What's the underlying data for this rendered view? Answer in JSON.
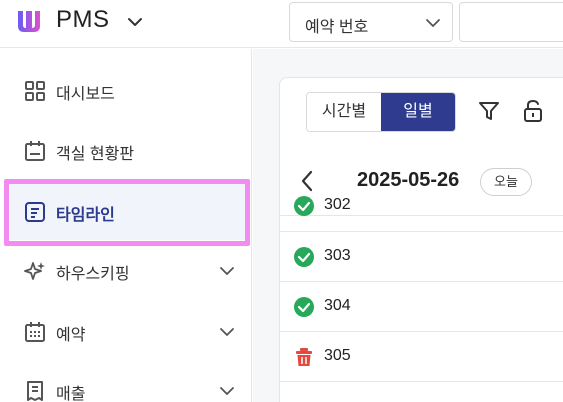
{
  "header": {
    "app_name": "PMS",
    "search_select_value": "예약 번호",
    "search_input_placeholder": ""
  },
  "sidebar": {
    "items": [
      {
        "label": "대시보드",
        "icon": "dashboard-grid-icon",
        "expandable": false,
        "active": false
      },
      {
        "label": "객실 현황판",
        "icon": "calendar-board-icon",
        "expandable": false,
        "active": false
      },
      {
        "label": "타임라인",
        "icon": "timeline-doc-icon",
        "expandable": false,
        "active": true
      },
      {
        "label": "하우스키핑",
        "icon": "sparkle-icon",
        "expandable": true,
        "active": false
      },
      {
        "label": "예약",
        "icon": "calendar-grid-icon",
        "expandable": true,
        "active": false
      },
      {
        "label": "매출",
        "icon": "receipt-icon",
        "expandable": true,
        "active": false
      }
    ]
  },
  "main": {
    "view_toggle": {
      "options": [
        "시간별",
        "일별"
      ],
      "selected": "일별"
    },
    "date": "2025-05-26",
    "today_label": "오늘",
    "rooms": [
      {
        "number": "302",
        "status": "check-circle-icon"
      },
      {
        "number": "303",
        "status": "check-circle-icon"
      },
      {
        "number": "304",
        "status": "check-circle-icon"
      },
      {
        "number": "305",
        "status": "trash-icon"
      }
    ]
  },
  "colors": {
    "accent": "#2e3b8f",
    "active_bg": "#f1f5fb",
    "highlight": "#f28cf0",
    "check_green": "#27a85a",
    "trash_red": "#e5483f"
  }
}
